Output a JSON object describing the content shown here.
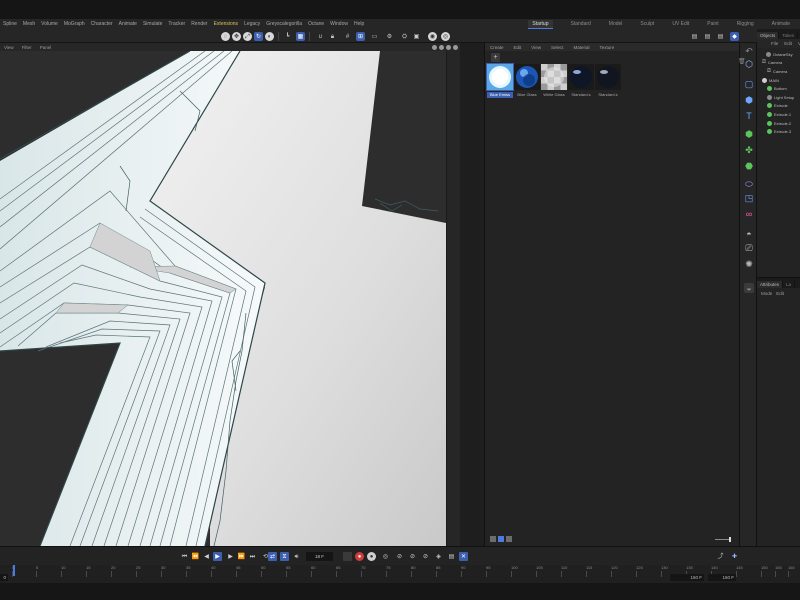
{
  "menubar": {
    "items": [
      "Spline",
      "Mesh",
      "Volume",
      "MoGraph",
      "Character",
      "Animate",
      "Simulate",
      "Tracker",
      "Render",
      "Extensions",
      "Legacy",
      "Greyscalegorilla",
      "Octane",
      "Window",
      "Help"
    ],
    "highlighted": "Extensions"
  },
  "layouts": {
    "tabs": [
      "Startup",
      "Standard",
      "Model",
      "Sculpt",
      "UV Edit",
      "Paint",
      "Rigging",
      "Animate"
    ],
    "active": "Startup"
  },
  "viewport": {
    "menu": [
      "View",
      "Filter",
      "Panel"
    ]
  },
  "material_manager": {
    "menu": [
      "Create",
      "Edit",
      "View",
      "Select",
      "Material",
      "Texture"
    ],
    "add_label": "+",
    "materials": [
      {
        "name": "Blue Emiss",
        "style": "emissive",
        "selected": true
      },
      {
        "name": "Blue Glass",
        "style": "glass-blue",
        "selected": false
      },
      {
        "name": "White Glass",
        "style": "checker",
        "selected": false
      },
      {
        "name": "Standard.s",
        "style": "dark",
        "selected": false
      },
      {
        "name": "Standard.s",
        "style": "dark",
        "selected": false
      }
    ]
  },
  "object_manager": {
    "tabs": [
      "Objects",
      "Takes"
    ],
    "menu": [
      "File",
      "Edit",
      "V"
    ],
    "objects": [
      {
        "name": "OctaneSky",
        "icon": "sky-icon",
        "color": "grey",
        "indent": 1
      },
      {
        "name": "Camera",
        "icon": "camera-icon",
        "color": "cam",
        "indent": 0
      },
      {
        "name": "Camera",
        "icon": "camera-icon",
        "color": "cam",
        "indent": 1
      },
      {
        "name": "MAIN",
        "icon": "null-icon",
        "color": "white",
        "indent": 0
      },
      {
        "name": "Bottom",
        "icon": "extrude-icon",
        "color": "green",
        "indent": 1
      },
      {
        "name": "Light Setup",
        "icon": "light-icon",
        "color": "grey",
        "indent": 1
      },
      {
        "name": "Extrude",
        "icon": "extrude-icon",
        "color": "green",
        "indent": 1
      },
      {
        "name": "Extrude.1",
        "icon": "extrude-icon",
        "color": "green",
        "indent": 1
      },
      {
        "name": "Extrude.2",
        "icon": "extrude-icon",
        "color": "green",
        "indent": 1
      },
      {
        "name": "Extrude.3",
        "icon": "extrude-icon",
        "color": "green",
        "indent": 1
      }
    ]
  },
  "attribute_manager": {
    "tabs": [
      "Attributes",
      "La"
    ],
    "menu": [
      "Mode",
      "Edit"
    ]
  },
  "timeline": {
    "current_frame": "18 F",
    "ruler_ticks": [
      "0",
      "5",
      "10",
      "15",
      "20",
      "25",
      "30",
      "35",
      "40",
      "45",
      "50",
      "55",
      "60",
      "65",
      "70",
      "75",
      "80",
      "85",
      "90",
      "95",
      "100",
      "105",
      "110",
      "115",
      "120",
      "125",
      "130",
      "135",
      "140",
      "145",
      "150",
      "155",
      "160"
    ],
    "start_frame": "0 F",
    "end_frame": "160 F",
    "end_frame2": "160 F"
  },
  "colors": {
    "accent": "#3c5fb0",
    "extension_highlight": "#d9c35a",
    "record": "#d03c3c",
    "object_green": "#5bc45b"
  }
}
